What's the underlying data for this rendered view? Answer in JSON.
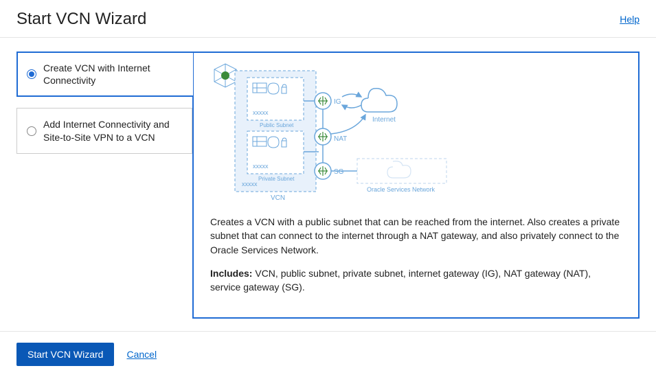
{
  "header": {
    "title": "Start VCN Wizard",
    "help": "Help"
  },
  "options": [
    {
      "label": "Create VCN with Internet Connectivity",
      "selected": true
    },
    {
      "label": "Add Internet Connectivity and Site-to-Site VPN to a VCN",
      "selected": false
    }
  ],
  "diagram": {
    "vcn_label": "VCN",
    "vcn_placeholder": "xxxxx",
    "public_subnet_label": "Public Subnet",
    "public_subnet_placeholder": "xxxxx",
    "private_subnet_label": "Private Subnet",
    "private_subnet_placeholder": "xxxxx",
    "ig_label": "IG",
    "nat_label": "NAT",
    "sg_label": "SG",
    "internet_label": "Internet",
    "osn_label": "Oracle Services Network"
  },
  "detail": {
    "description": "Creates a VCN with a public subnet that can be reached from the internet. Also creates a private subnet that can connect to the internet through a NAT gateway, and also privately connect to the Oracle Services Network.",
    "includes_label": "Includes:",
    "includes_text": " VCN, public subnet, private subnet, internet gateway (IG), NAT gateway (NAT), service gateway (SG)."
  },
  "footer": {
    "start": "Start VCN Wizard",
    "cancel": "Cancel"
  }
}
